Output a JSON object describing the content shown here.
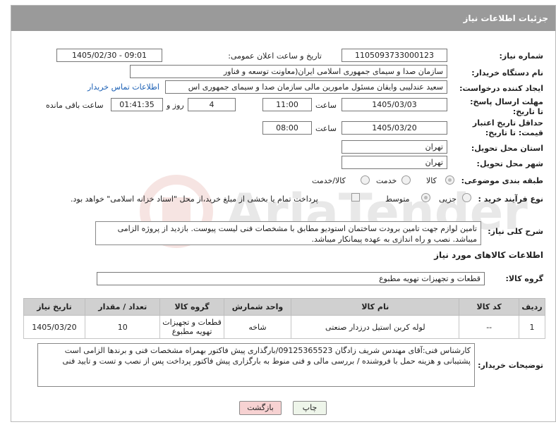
{
  "header": {
    "title": "جزئیات اطلاعات نیاز"
  },
  "fields": {
    "need_number_label": "شماره نیاز:",
    "need_number": "1105093733000123",
    "announce_label": "تاریخ و ساعت اعلان عمومی:",
    "announce_value": "1405/02/30 - 09:01",
    "buyer_org_label": "نام دستگاه خریدار:",
    "buyer_org": "سازمان صدا و سیمای جمهوری اسلامی ایران(معاونت توسعه و فناور",
    "requester_label": "ایجاد کننده درخواست:",
    "requester": "سعید عندلیبی وایقان مسئول مامورین مالی  سازمان صدا و سیمای جمهوری اس",
    "contact_link": "اطلاعات تماس خریدار",
    "deadline_label": "مهلت ارسال پاسخ: تا تاریخ:",
    "deadline_date": "1405/03/03",
    "time_label": "ساعت",
    "deadline_time": "11:00",
    "days_value": "4",
    "days_label": "روز و",
    "remaining_time": "01:41:35",
    "remaining_label": "ساعت باقی مانده",
    "price_validity_label": "حداقل تاریخ اعتبار قیمت: تا تاریخ:",
    "validity_date": "1405/03/20",
    "validity_time": "08:00",
    "province_label": "استان محل تحویل:",
    "province": "تهران",
    "city_label": "شهر محل تحویل:",
    "city": "تهران",
    "category_label": "طبقه بندی موضوعی:",
    "category_options": [
      "کالا",
      "خدمت",
      "کالا/خدمت"
    ],
    "process_label": "نوع فرآیند خرید :",
    "process_options": [
      "جزیی",
      "متوسط"
    ],
    "payment_note": "پرداخت تمام یا بخشی از مبلغ خرید،از محل \"اسناد خزانه اسلامی\" خواهد بود."
  },
  "description": {
    "label": "شرح کلی نیاز:",
    "text": "تامین لوازم جهت تامین برودت ساختمان استودیو مطابق با مشخصات فنی لیست پیوست. بازدید از پروژه الزامی میباشد. نصب و راه اندازی به عهده پیمانکار میباشد."
  },
  "goods": {
    "section_title": "اطلاعات کالاهای مورد نیاز",
    "group_label": "گروه کالا:",
    "group_value": "قطعات و تجهیزات تهویه مطبوع",
    "columns": [
      "ردیف",
      "کد کالا",
      "نام کالا",
      "واحد شمارش",
      "گروه کالا",
      "تعداد / مقدار",
      "تاریخ نیاز"
    ],
    "rows": [
      [
        "1",
        "--",
        "لوله کربن استیل درزدار صنعتی",
        "شاخه",
        "قطعات و تجهیزات تهویه مطبوع",
        "10",
        "1405/03/20"
      ]
    ]
  },
  "buyer_notes": {
    "label": "توضیحات خریدار:",
    "text": "کارشناس فنی:آقای مهندس شریف زادگان 09125365523/بارگذاری پیش فاکتور بهمراه مشخصات فنی و برندها الزامی است پشتیبانی و هزینه حمل با فروشنده / بررسی مالی و فنی منوط به بارگزاری پیش فاکتور پرداخت پس از نصب و تست و تایید فنی"
  },
  "buttons": {
    "print": "چاپ",
    "back": "بازگشت"
  },
  "colors": {
    "header": "#9a9a9a",
    "link": "#1a5fb4",
    "back_button": "#f7d2d2",
    "print_button": "#eef5ea"
  }
}
